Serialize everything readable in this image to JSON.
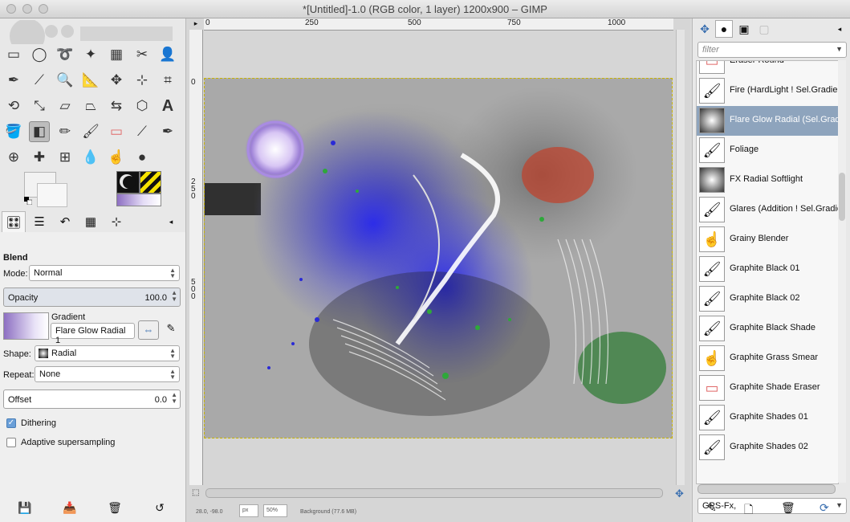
{
  "window": {
    "title": "*[Untitled]-1.0 (RGB color, 1 layer) 1200x900 – GIMP"
  },
  "toolbox": {
    "tools": [
      "rect-select",
      "ellipse-select",
      "free-select",
      "fuzzy-select",
      "color-select",
      "scissors",
      "foreground-select",
      "paths",
      "color-picker",
      "zoom",
      "measure",
      "move",
      "align",
      "crop",
      "rotate",
      "scale",
      "shear",
      "perspective",
      "flip",
      "cage",
      "text",
      "bucket-fill",
      "blend",
      "pencil",
      "paintbrush",
      "eraser",
      "airbrush",
      "ink",
      "clone",
      "heal",
      "perspective-clone",
      "blur",
      "smudge",
      "dodge-burn"
    ],
    "active_tool": "blend",
    "tabs": [
      "tool-options",
      "layers",
      "undo-history",
      "brushes-tab",
      "navigation"
    ]
  },
  "tool_options": {
    "title": "Blend",
    "mode_label": "Mode:",
    "mode_value": "Normal",
    "opacity_label": "Opacity",
    "opacity_value": "100.0",
    "gradient_label": "Gradient",
    "gradient_value": "Flare Glow Radial 1",
    "shape_label": "Shape:",
    "shape_value": "Radial",
    "repeat_label": "Repeat:",
    "repeat_value": "None",
    "offset_label": "Offset",
    "offset_value": "0.0",
    "dithering_label": "Dithering",
    "dithering_checked": true,
    "adaptive_label": "Adaptive supersampling",
    "adaptive_checked": false
  },
  "rulers": {
    "h_ticks": [
      "0",
      "250",
      "500",
      "750",
      "1000"
    ],
    "v_ticks": [
      "0",
      "2\n5\n0",
      "5\n0\n0"
    ]
  },
  "status": {
    "coords": "28.0, -98.0",
    "unit": "px",
    "zoom": "50%",
    "info": "Background (77.6 MB)"
  },
  "brushes": {
    "filter_placeholder": "filter",
    "items": [
      {
        "name": "Eraser Round",
        "icon": "eraser-icon"
      },
      {
        "name": "Fire (HardLight ! Sel.Gradient)",
        "icon": "brush-icon"
      },
      {
        "name": "Flare Glow Radial (Sel.Gradient)",
        "icon": "gradient-icon",
        "selected": true
      },
      {
        "name": "Foliage",
        "icon": "brush-icon"
      },
      {
        "name": "FX Radial Softlight",
        "icon": "gradient-icon"
      },
      {
        "name": "Glares (Addition ! Sel.Gradient)",
        "icon": "brush-icon"
      },
      {
        "name": "Grainy Blender",
        "icon": "smudge-icon"
      },
      {
        "name": "Graphite Black 01",
        "icon": "brush-icon"
      },
      {
        "name": "Graphite Black 02",
        "icon": "brush-icon"
      },
      {
        "name": "Graphite Black Shade",
        "icon": "brush-icon"
      },
      {
        "name": "Graphite Grass Smear",
        "icon": "smudge-icon"
      },
      {
        "name": "Graphite Shade Eraser",
        "icon": "eraser-icon"
      },
      {
        "name": "Graphite Shades 01",
        "icon": "brush-icon"
      },
      {
        "name": "Graphite Shades 02",
        "icon": "brush-icon"
      }
    ],
    "tag_value": "GPS-Fx,"
  }
}
